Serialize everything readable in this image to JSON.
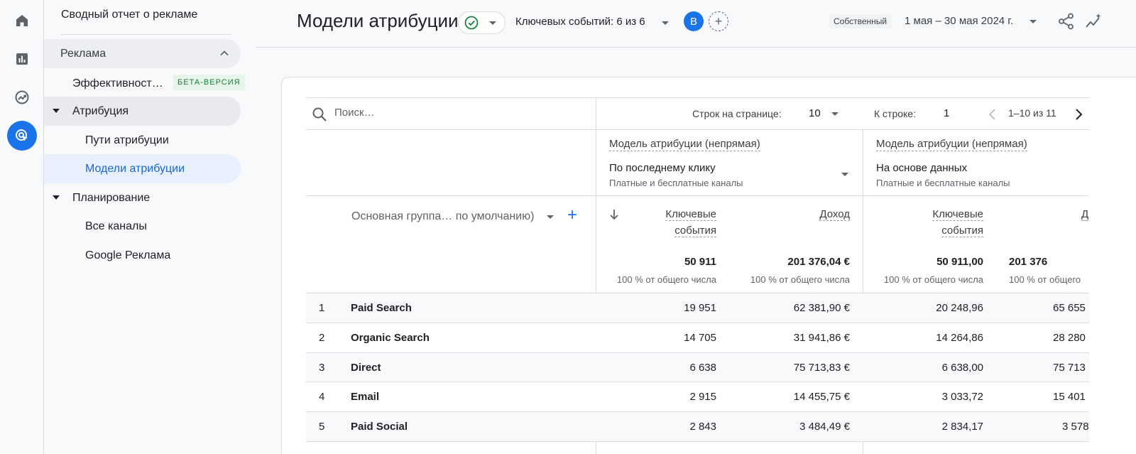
{
  "rail": {
    "items": [
      {
        "icon": "home-icon"
      },
      {
        "icon": "reports-icon"
      },
      {
        "icon": "explore-icon"
      },
      {
        "icon": "advertising-icon",
        "active": true
      }
    ]
  },
  "nav": {
    "title": "Сводный отчет о рекламе",
    "group_label": "Реклама",
    "performance_label": "Эффективност…",
    "beta_badge": "БЕТА-ВЕРСИЯ",
    "attribution_label": "Атрибуция",
    "paths_label": "Пути атрибуции",
    "models_label": "Модели атрибуции",
    "planning_label": "Планирование",
    "all_channels_label": "Все каналы",
    "google_ads_label": "Google Реклама"
  },
  "header": {
    "title": "Модели атрибуции",
    "key_events": "Ключевых событий: 6 из 6",
    "avatar_letter": "B",
    "add_comparison": "+",
    "own_badge": "Собственный",
    "date_range": "1 мая – 30 мая 2024 г."
  },
  "table": {
    "search_placeholder": "Поиск…",
    "rows_per_page_label": "Строк на странице:",
    "rows_per_page": "10",
    "go_to_label": "К строке:",
    "go_to_value": "1",
    "pagination": "1–10 из 11",
    "dimension_label": "Основная группа… по умолчанию)",
    "models": [
      {
        "title": "Модель атрибуции (непрямая)",
        "name": "По последнему клику",
        "sub": "Платные и бесплатные каналы"
      },
      {
        "title": "Модель атрибуции (непрямая)",
        "name": "На основе данных",
        "sub": "Платные и бесплатные каналы"
      }
    ],
    "col_key_events_1": "Ключевые",
    "col_key_events_2": "события",
    "col_revenue": "Доход",
    "col_revenue_cut": "Д",
    "totals": {
      "m1_events": "50 911",
      "m1_revenue": "201 376,04 €",
      "m2_events": "50 911,00",
      "m2_revenue": "201 376",
      "pct": "100 % от общего числа",
      "pct_cut": "100 % от общего"
    },
    "rows": [
      {
        "idx": "1",
        "name": "Paid Search",
        "m1_events": "19 951",
        "m1_revenue": "62 381,90 €",
        "m2_events": "20 248,96",
        "m2_revenue": "65 655"
      },
      {
        "idx": "2",
        "name": "Organic Search",
        "m1_events": "14 705",
        "m1_revenue": "31 941,86 €",
        "m2_events": "14 264,86",
        "m2_revenue": "28 280"
      },
      {
        "idx": "3",
        "name": "Direct",
        "m1_events": "6 638",
        "m1_revenue": "75 713,83 €",
        "m2_events": "6 638,00",
        "m2_revenue": "75 713"
      },
      {
        "idx": "4",
        "name": "Email",
        "m1_events": "2 915",
        "m1_revenue": "14 455,75 €",
        "m2_events": "3 033,72",
        "m2_revenue": "15 401"
      },
      {
        "idx": "5",
        "name": "Paid Social",
        "m1_events": "2 843",
        "m1_revenue": "3 484,49 €",
        "m2_events": "2 834,17",
        "m2_revenue": "3 578"
      }
    ]
  },
  "colors": {
    "accent": "#1a73e8",
    "active_nav_bg": "#e8f0fe",
    "active_nav_text": "#1967d2",
    "beta_bg": "#e6f4ea",
    "beta_text": "#188038",
    "check_green": "#188038"
  }
}
